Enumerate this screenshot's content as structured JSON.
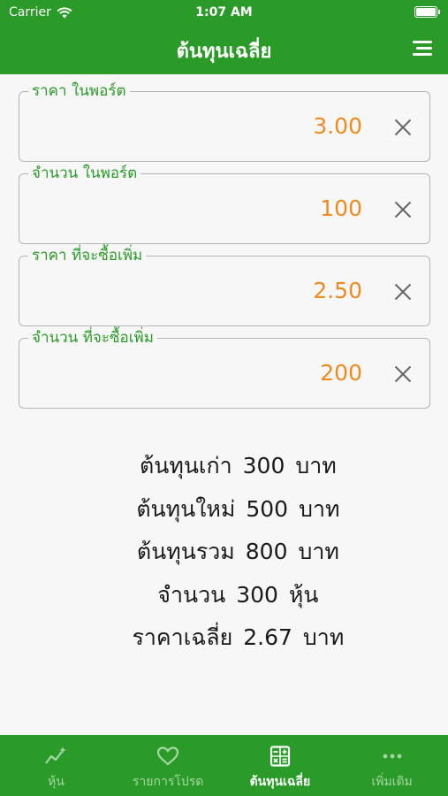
{
  "status": {
    "carrier": "Carrier",
    "time": "1:07 AM"
  },
  "nav": {
    "title": "ต้นทุนเฉลี่ย"
  },
  "fields": [
    {
      "label": "ราคา ในพอร์ต",
      "value": "3.00"
    },
    {
      "label": "จำนวน ในพอร์ต",
      "value": "100"
    },
    {
      "label": "ราคา ที่จะซื้อเพิ่ม",
      "value": "2.50"
    },
    {
      "label": "จำนวน ที่จะซื้อเพิ่ม",
      "value": "200"
    }
  ],
  "results": [
    {
      "label": "ต้นทุนเก่า",
      "value": "300",
      "unit": "บาท"
    },
    {
      "label": "ต้นทุนใหม่",
      "value": "500",
      "unit": "บาท"
    },
    {
      "label": "ต้นทุนรวม",
      "value": "800",
      "unit": "บาท"
    },
    {
      "label": "จำนวน",
      "value": "300",
      "unit": "หุ้น"
    },
    {
      "label": "ราคาเฉลี่ย",
      "value": "2.67",
      "unit": "บาท"
    }
  ],
  "tabs": [
    {
      "label": "หุ้น",
      "icon": "chart-sparkle-icon",
      "active": false
    },
    {
      "label": "รายการโปรด",
      "icon": "heart-icon",
      "active": false
    },
    {
      "label": "ต้นทุนเฉลี่ย",
      "icon": "calculator-icon",
      "active": true
    },
    {
      "label": "เพิ่มเติม",
      "icon": "more-dots-icon",
      "active": false
    }
  ],
  "colors": {
    "brand": "#2a9b28",
    "value": "#ef8a1e",
    "inactive_tab": "#a6d6a3"
  }
}
